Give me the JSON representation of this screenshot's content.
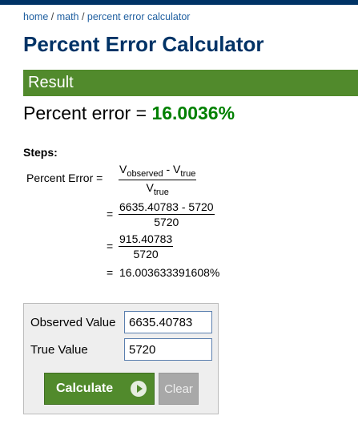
{
  "breadcrumb": {
    "home": "home",
    "sep1": " / ",
    "math": "math",
    "sep2": " / ",
    "current": "percent error calculator"
  },
  "page": {
    "title": "Percent Error Calculator"
  },
  "result": {
    "header": "Result",
    "label": "Percent error = ",
    "value": "16.0036%"
  },
  "steps": {
    "label": "Steps:",
    "lhs": "Percent Error =",
    "equals": "=",
    "formula": {
      "num_v": "V",
      "num_sub1": "observed",
      "num_minus": " - V",
      "num_sub2": "true",
      "den_v": "V",
      "den_sub": "true"
    },
    "step2": {
      "numerator": "6635.40783 - 5720",
      "denominator": "5720"
    },
    "step3": {
      "numerator": "915.40783",
      "denominator": "5720"
    },
    "final": "16.003633391608%"
  },
  "form": {
    "observed_label": "Observed Value",
    "observed_value": "6635.40783",
    "true_label": "True Value",
    "true_value": "5720",
    "calculate_label": "Calculate",
    "clear_label": "Clear"
  },
  "colors": {
    "title": "#003366",
    "accent_green": "#518A2C",
    "result_value": "#008000",
    "link": "#1f5fa0"
  }
}
